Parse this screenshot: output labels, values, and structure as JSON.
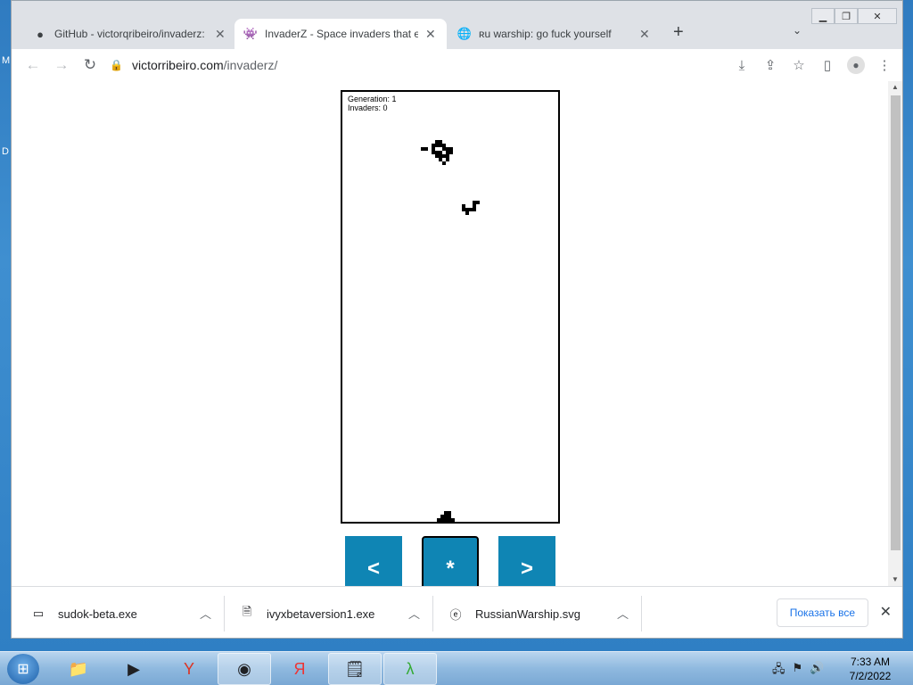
{
  "browser": {
    "tabs": [
      {
        "label": "GitHub - victorqribeiro/invaderz: ",
        "favicon": "github-icon",
        "active": false
      },
      {
        "label": "InvaderZ - Space invaders that ev",
        "favicon": "invader-icon",
        "active": true
      },
      {
        "label": "ʀu warship: go fuck yourself",
        "favicon": "globe-icon",
        "active": false
      }
    ],
    "address": {
      "host": "victorribeiro.com",
      "path": "/invaderz/"
    }
  },
  "game": {
    "hud_generation": "Generation: 1",
    "hud_invaders": "Invaders: 0",
    "buttons": [
      "<",
      "*",
      ">"
    ],
    "selected_button": 1
  },
  "downloads": {
    "items": [
      {
        "name": "sudok-beta.exe",
        "icon": "exe-file-icon"
      },
      {
        "name": "ivyxbetaversion1.exe",
        "icon": "installer-file-icon"
      },
      {
        "name": "RussianWarship.svg",
        "icon": "edge-file-icon"
      }
    ],
    "show_all_label": "Показать все"
  },
  "taskbar": {
    "apps": [
      "explorer-icon",
      "media-player-icon",
      "yandex-browser-icon",
      "chrome-icon",
      "yandex-icon",
      "notepad-icon",
      "lambda-icon"
    ],
    "time": "7:33 AM",
    "date": "7/2/2022"
  },
  "desktop": {
    "edge_letters": [
      "M",
      "D"
    ]
  }
}
